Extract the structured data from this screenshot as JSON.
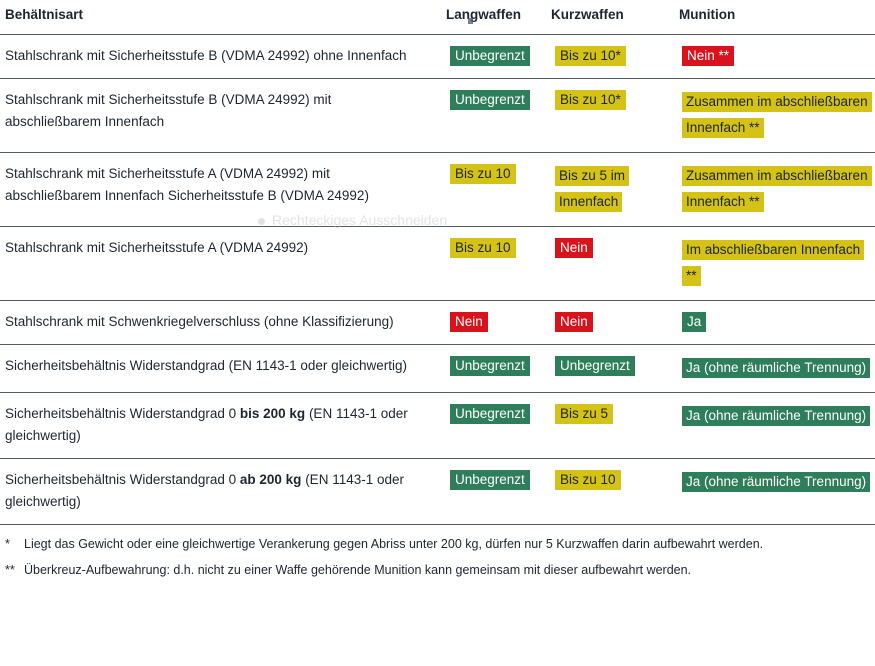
{
  "table": {
    "columns": [
      {
        "key": "art",
        "label": "Behältnisart"
      },
      {
        "key": "lang",
        "label": "Langwaffen"
      },
      {
        "key": "kurz",
        "label": "Kurzwaffen"
      },
      {
        "key": "muni",
        "label": "Munition"
      }
    ],
    "rows": [
      {
        "art": "Stahlschrank mit Sicherheitsstufe B (VDMA 24992) ohne Innenfach",
        "lang": {
          "text": "Unbegrenzt",
          "color": "green"
        },
        "kurz": {
          "text": "Bis zu 10*",
          "color": "yellow"
        },
        "muni": {
          "text": "Nein **",
          "color": "red"
        }
      },
      {
        "art": "Stahlschrank mit Sicherheitsstufe B (VDMA 24992) mit abschließbarem Innenfach",
        "lang": {
          "text": "Unbegrenzt",
          "color": "green"
        },
        "kurz": {
          "text": "Bis zu 10*",
          "color": "yellow"
        },
        "muni": {
          "text": "Zusammen im abschließbaren Innenfach **",
          "color": "yellow",
          "multiline": true
        }
      },
      {
        "art": "Stahlschrank mit Sicherheitsstufe A (VDMA 24992) mit abschließbarem Innenfach Sicherheitsstufe B (VDMA 24992)",
        "lang": {
          "text": "Bis zu 10",
          "color": "yellow"
        },
        "kurz": {
          "text": "Bis zu 5 im Innenfach",
          "color": "yellow",
          "multiline": true
        },
        "muni": {
          "text": "Zusammen im abschließbaren Innenfach **",
          "color": "yellow",
          "multiline": true
        }
      },
      {
        "art": "Stahlschrank mit Sicherheitsstufe A (VDMA 24992)",
        "lang": {
          "text": "Bis zu 10",
          "color": "yellow"
        },
        "kurz": {
          "text": "Nein",
          "color": "red"
        },
        "muni": {
          "text": "Im abschließbaren Innenfach **",
          "color": "yellow",
          "multiline": true
        }
      },
      {
        "art": "Stahlschrank mit Schwenkriegelverschluss (ohne Klassifizierung)",
        "lang": {
          "text": "Nein",
          "color": "red"
        },
        "kurz": {
          "text": "Nein",
          "color": "red"
        },
        "muni": {
          "text": "Ja",
          "color": "green"
        }
      },
      {
        "art": "Sicherheitsbehältnis Widerstandgrad (EN 1143-1 oder gleichwertig)",
        "lang": {
          "text": "Unbegrenzt",
          "color": "green"
        },
        "kurz": {
          "text": "Unbegrenzt",
          "color": "green"
        },
        "muni": {
          "text": "Ja (ohne räumliche Trennung)",
          "color": "green",
          "multiline": true
        }
      },
      {
        "art_parts": [
          {
            "text": "Sicherheitsbehältnis Widerstandgrad 0 ",
            "bold": false
          },
          {
            "text": "bis 200 kg",
            "bold": true
          },
          {
            "text": " (EN 1143-1 oder gleichwertig)",
            "bold": false
          }
        ],
        "lang": {
          "text": "Unbegrenzt",
          "color": "green"
        },
        "kurz": {
          "text": "Bis zu 5",
          "color": "yellow"
        },
        "muni": {
          "text": "Ja (ohne räumliche Trennung)",
          "color": "green",
          "multiline": true
        }
      },
      {
        "art_parts": [
          {
            "text": "Sicherheitsbehältnis Widerstandgrad 0 ",
            "bold": false
          },
          {
            "text": "ab 200 kg",
            "bold": true
          },
          {
            "text": " (EN 1143-1 oder gleichwertig)",
            "bold": false
          }
        ],
        "lang": {
          "text": "Unbegrenzt",
          "color": "green"
        },
        "kurz": {
          "text": "Bis zu 10",
          "color": "yellow"
        },
        "muni": {
          "text": "Ja (ohne räumliche Trennung)",
          "color": "green",
          "multiline": true
        }
      }
    ]
  },
  "footnotes": [
    {
      "mark": "*",
      "text": "Liegt das Gewicht oder eine gleichwertige Verankerung gegen Abriss unter 200 kg, dürfen nur 5 Kurzwaffen darin aufbewahrt werden."
    },
    {
      "mark": "**",
      "text": "Überkreuz-Aufbewahrung: d.h. nicht zu einer Waffe gehörende Munition kann gemeinsam mit dieser aufbewahrt werden."
    }
  ],
  "artifact": {
    "ghost_label": "Rechteckiges Ausschneiden"
  },
  "colors": {
    "green": "#2e7d5b",
    "yellow": "#d4c217",
    "red": "#d8131c",
    "text": "#1d2530",
    "rule": "#555c66"
  }
}
